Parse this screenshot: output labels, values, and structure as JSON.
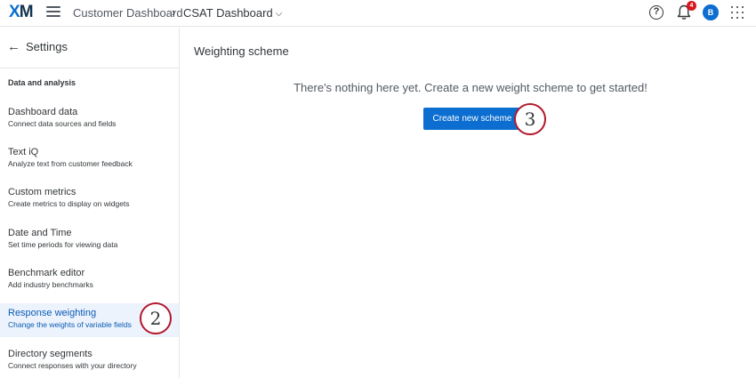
{
  "header": {
    "logo_x": "X",
    "logo_m": "M",
    "breadcrumb_project": "Customer Dashboard",
    "breadcrumb_separator": "›",
    "breadcrumb_dashboard": "CSAT Dashboard",
    "dropdown_glyph": "⌵",
    "help_glyph": "?",
    "notification_count": "4",
    "avatar_initial": "B",
    "icons": [
      "menu-icon",
      "chevron-down-icon",
      "help-icon",
      "bell-icon",
      "apps-grid-icon"
    ]
  },
  "sidebar": {
    "back_arrow": "←",
    "back_label": "Settings",
    "section_label": "Data and analysis",
    "items": [
      {
        "title": "Dashboard data",
        "subtitle": "Connect data sources and fields"
      },
      {
        "title": "Text iQ",
        "subtitle": "Analyze text from customer feedback"
      },
      {
        "title": "Custom metrics",
        "subtitle": "Create metrics to display on widgets"
      },
      {
        "title": "Date and Time",
        "subtitle": "Set time periods for viewing data"
      },
      {
        "title": "Benchmark editor",
        "subtitle": "Add industry benchmarks"
      },
      {
        "title": "Response weighting",
        "subtitle": "Change the weights of variable fields",
        "active": true
      },
      {
        "title": "Directory segments",
        "subtitle": "Connect responses with your directory"
      }
    ]
  },
  "main": {
    "title": "Weighting scheme",
    "empty_message": "There's nothing here yet. Create a new weight scheme to get started!",
    "create_button_label": "Create new scheme"
  },
  "annotations": {
    "step_2": "2",
    "step_3": "3"
  },
  "colors": {
    "brand_blue": "#0b6ed0",
    "active_bg": "#edf3fc",
    "active_text": "#0b5bb5",
    "annotation_red": "#b2182b",
    "badge_red": "#d7171f"
  }
}
